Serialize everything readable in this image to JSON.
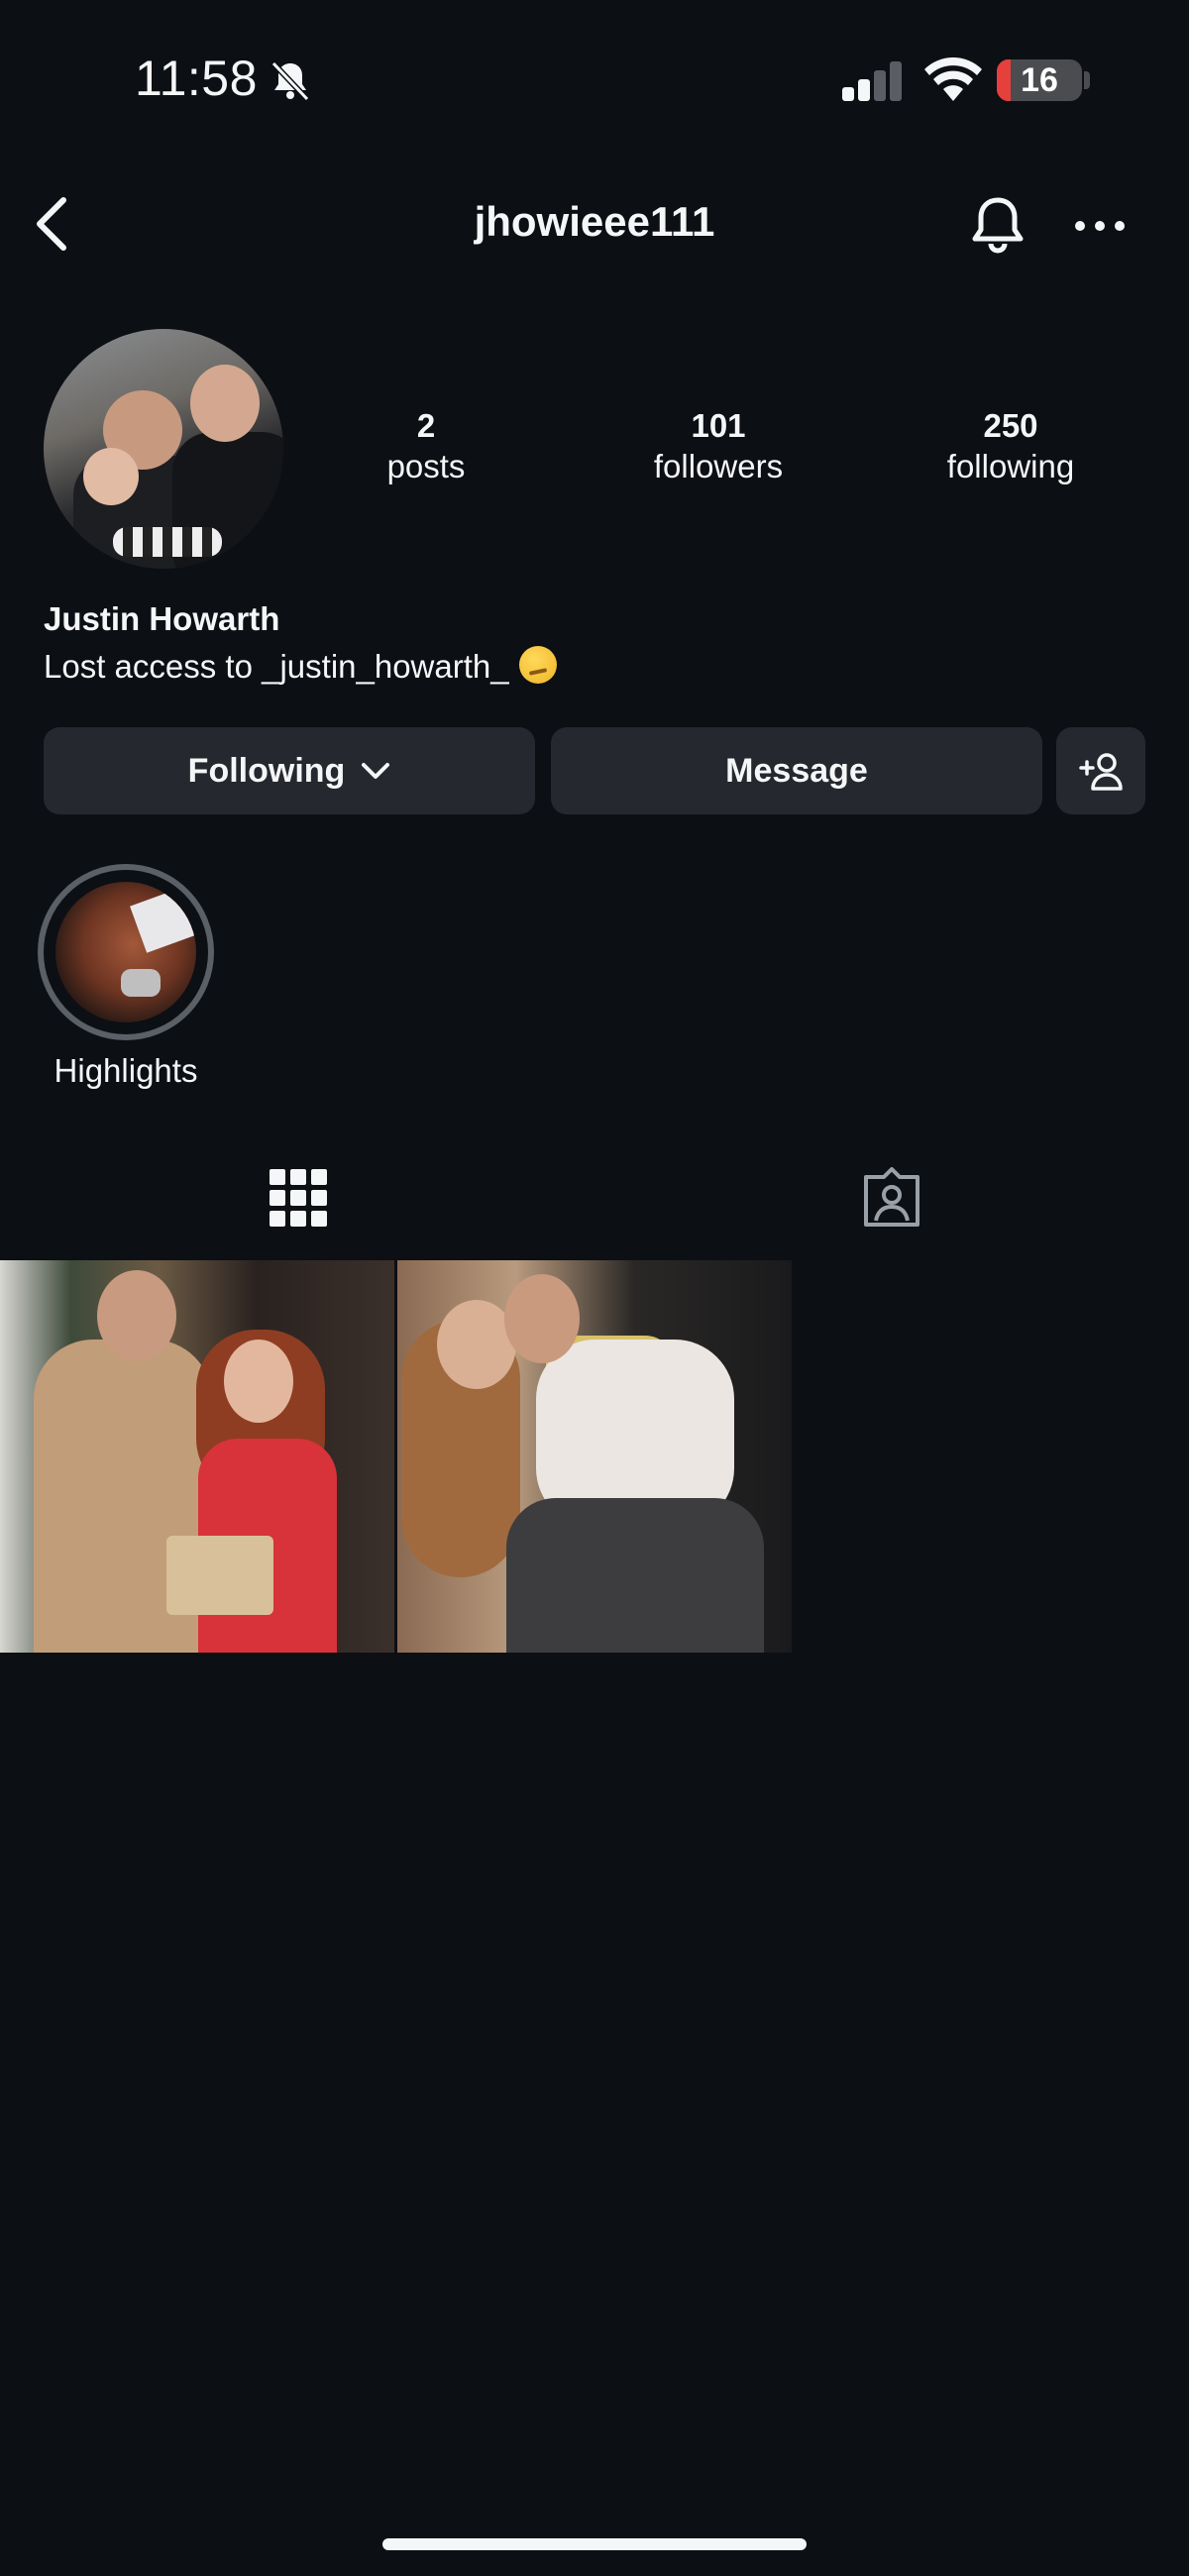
{
  "status_bar": {
    "time": "11:58",
    "battery_level": "16",
    "battery_color": "#e5403b"
  },
  "header": {
    "username": "jhowieee111",
    "icons": [
      "back-icon",
      "bell-icon",
      "more-icon"
    ]
  },
  "profile": {
    "stats": [
      {
        "value": "2",
        "label": "posts"
      },
      {
        "value": "101",
        "label": "followers"
      },
      {
        "value": "250",
        "label": "following"
      }
    ],
    "name": "Justin Howarth",
    "bio": "Lost access to _justin_howarth_"
  },
  "actions": {
    "following_label": "Following",
    "message_label": "Message"
  },
  "highlights": [
    {
      "label": "Highlights"
    }
  ],
  "tabs": [
    "grid-icon",
    "tagged-icon"
  ],
  "posts_count": 2,
  "colors": {
    "background": "#0c0f14",
    "button": "#25282e",
    "text": "#f5f6f7"
  }
}
